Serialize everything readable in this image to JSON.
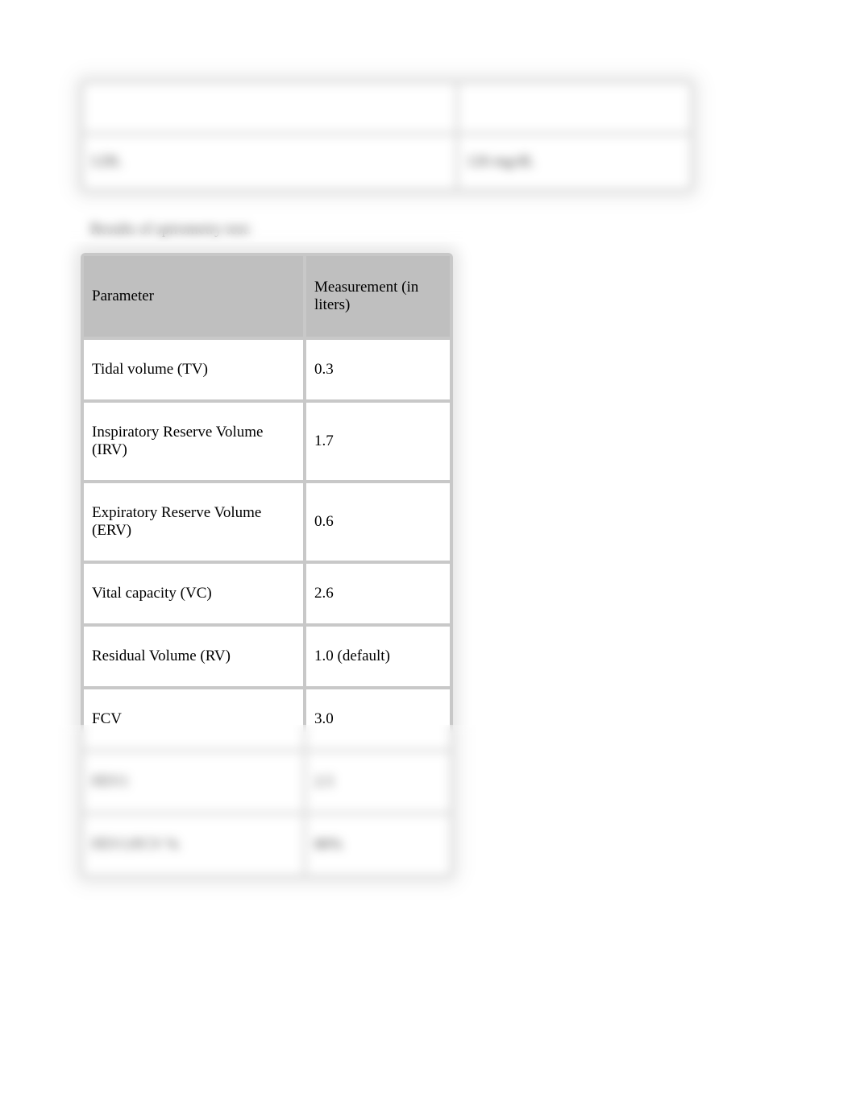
{
  "top_table": {
    "headers": [
      "",
      ""
    ],
    "rows": [
      {
        "label": "LDL",
        "value": "126 mg/dL"
      }
    ]
  },
  "section_label": "Results of spirometry test:",
  "spirometry_table": {
    "headers": [
      "Parameter",
      "Measurement (in liters)"
    ],
    "rows": [
      {
        "param": "Tidal volume (TV)",
        "value": " 0.3"
      },
      {
        "param": "Inspiratory Reserve Volume (IRV)",
        "value": " 1.7"
      },
      {
        "param": "Expiratory Reserve Volume (ERV)",
        "value": " 0.6"
      },
      {
        "param": "Vital capacity (VC)",
        "value": " 2.6"
      },
      {
        "param": "Residual Volume (RV)",
        "value": "1.0  (default)"
      },
      {
        "param": "FCV",
        "value": "3.0"
      },
      {
        "param": "FEV1",
        "value": "2.5"
      },
      {
        "param": "FEV1/FCV %",
        "value": "80%"
      }
    ]
  }
}
